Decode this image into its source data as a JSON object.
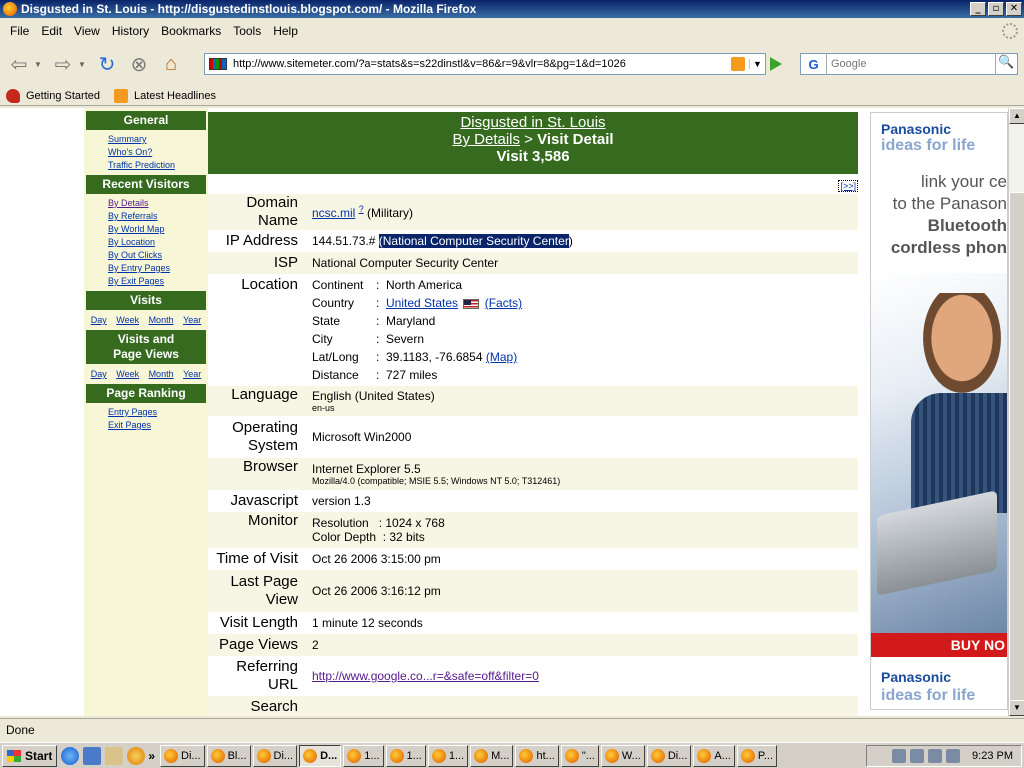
{
  "window": {
    "title": "Disgusted in St. Louis - http://disgustedinstlouis.blogspot.com/ - Mozilla Firefox"
  },
  "menu": [
    "File",
    "Edit",
    "View",
    "History",
    "Bookmarks",
    "Tools",
    "Help"
  ],
  "nav": {
    "url": "http://www.sitemeter.com/?a=stats&s=s22dinstl&v=86&r=9&vlr=8&pg=1&d=1026",
    "search_engine": "G",
    "search_placeholder": "Google"
  },
  "bookmarks": [
    "Getting Started",
    "Latest Headlines"
  ],
  "sidebar": {
    "general": {
      "heading": "General",
      "links": [
        "Summary",
        "Who's On?",
        "Traffic Prediction"
      ]
    },
    "recent": {
      "heading": "Recent Visitors",
      "links": [
        "By Details",
        "By Referrals",
        "By World Map",
        "By Location",
        "By Out Clicks",
        "By Entry Pages",
        "By Exit Pages"
      ]
    },
    "visits": {
      "heading": "Visits",
      "periods": [
        "Day",
        "Week",
        "Month",
        "Year"
      ]
    },
    "visits_pv": {
      "heading_1": "Visits and",
      "heading_2": "Page Views",
      "periods": [
        "Day",
        "Week",
        "Month",
        "Year"
      ]
    },
    "ranking": {
      "heading": "Page Ranking",
      "links": [
        "Entry Pages",
        "Exit Pages"
      ]
    }
  },
  "header": {
    "site": "Disgusted in St. Louis",
    "crumb_link": "By Details",
    "crumb_sep": " > ",
    "crumb_current": "Visit Detail",
    "visit": "Visit 3,586",
    "next": "[>>]"
  },
  "detail": {
    "domain": {
      "label_1": "Domain",
      "label_2": "Name",
      "link": "ncsc.mil",
      "sup": "?",
      "note": " (Military)"
    },
    "ip": {
      "label": "IP Address",
      "value": "144.51.73.# ",
      "selected": "(National Computer Security Center",
      "after": ")"
    },
    "isp": {
      "label": "ISP",
      "value": "National Computer Security Center"
    },
    "location": {
      "label": "Location",
      "continent_k": "Continent",
      "continent_v": "North America",
      "country_k": "Country",
      "country_v": "United States",
      "country_facts": "(Facts)",
      "state_k": "State",
      "state_v": "Maryland",
      "city_k": "City",
      "city_v": "Severn",
      "latlong_k": "Lat/Long",
      "latlong_v": "39.1183, -76.6854",
      "latlong_map": "(Map)",
      "distance_k": "Distance",
      "distance_v": "727 miles",
      "sep": ":"
    },
    "language": {
      "label": "Language",
      "value": "English (United States)",
      "code": "en-us"
    },
    "os": {
      "label_1": "Operating",
      "label_2": "System",
      "value": "Microsoft Win2000"
    },
    "browser": {
      "label": "Browser",
      "value": "Internet Explorer 5.5",
      "ua": "Mozilla/4.0 (compatible; MSIE 5.5; Windows NT 5.0; T312461)"
    },
    "javascript": {
      "label": "Javascript",
      "value": "version 1.3"
    },
    "monitor": {
      "label": "Monitor",
      "resolution": "Resolution   : 1024 x 768",
      "depth": "Color Depth  : 32 bits"
    },
    "time_of_visit": {
      "label": "Time of Visit",
      "value": "Oct 26 2006 3:15:00 pm"
    },
    "last_page": {
      "label_1": "Last Page",
      "label_2": "View",
      "value": "Oct 26 2006 3:16:12 pm"
    },
    "visit_length": {
      "label": "Visit Length",
      "value": "1 minute 12 seconds"
    },
    "page_views": {
      "label": "Page Views",
      "value": "2"
    },
    "referring": {
      "label_1": "Referring",
      "label_2": "URL",
      "value": "http://www.google.co...r=&safe=off&filter=0"
    },
    "search": {
      "label": "Search"
    }
  },
  "ad": {
    "brand": "Panasonic",
    "tagline": "ideas for life",
    "copy_1": "link your ce",
    "copy_2": "to the Panason",
    "copy_3": "Bluetooth",
    "copy_4": "cordless phon",
    "cta": "BUY NO"
  },
  "status": "Done",
  "taskbar": {
    "start": "Start",
    "tasks": [
      "Di...",
      "Bl...",
      "Di...",
      "D...",
      "1...",
      "1...",
      "1...",
      "M...",
      "ht...",
      "\"...",
      "W...",
      "Di...",
      "A...",
      "P..."
    ],
    "active_index": 3,
    "clock": "9:23 PM"
  },
  "colors": {
    "sidebar_head": "#366b1f",
    "sidebar_bg": "#f7f6d6",
    "row_alt": "#f7f6e4",
    "link": "#0033aa",
    "visited": "#551a8b",
    "selection": "#0a246a"
  }
}
